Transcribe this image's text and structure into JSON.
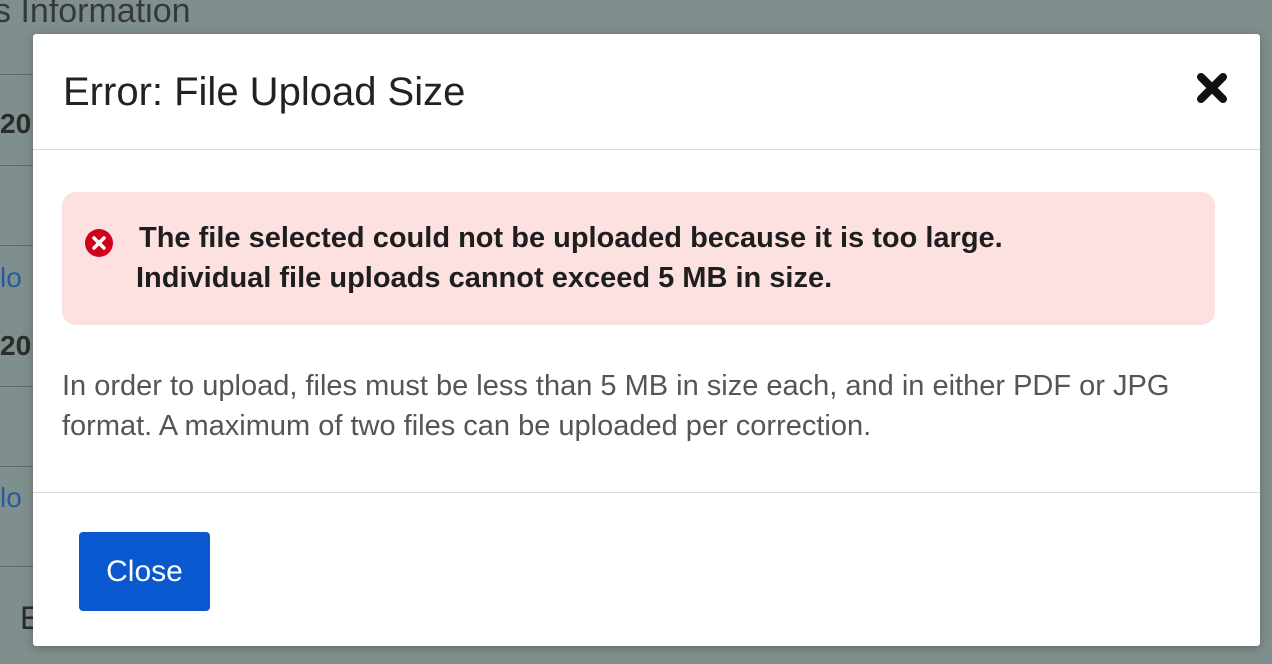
{
  "background": {
    "heading_fragment": "s Information",
    "edge_fragments": [
      "20",
      "lo",
      "20",
      "lo",
      "E"
    ]
  },
  "modal": {
    "title": "Error: File Upload Size",
    "close_icon": "close-x-icon",
    "alert": {
      "icon": "error-circle-icon",
      "line1": "The file selected could not be uploaded because it is too large.",
      "line2": "Individual file uploads cannot exceed 5 MB in size.",
      "background_color": "#fde0e0",
      "icon_color": "#d0021b"
    },
    "info_text": "In order to upload, files must be less than 5 MB in size each, and in either PDF or JPG format. A maximum of two files can be uploaded per correction.",
    "footer": {
      "close_button_label": "Close",
      "button_color": "#0a58d0"
    }
  }
}
